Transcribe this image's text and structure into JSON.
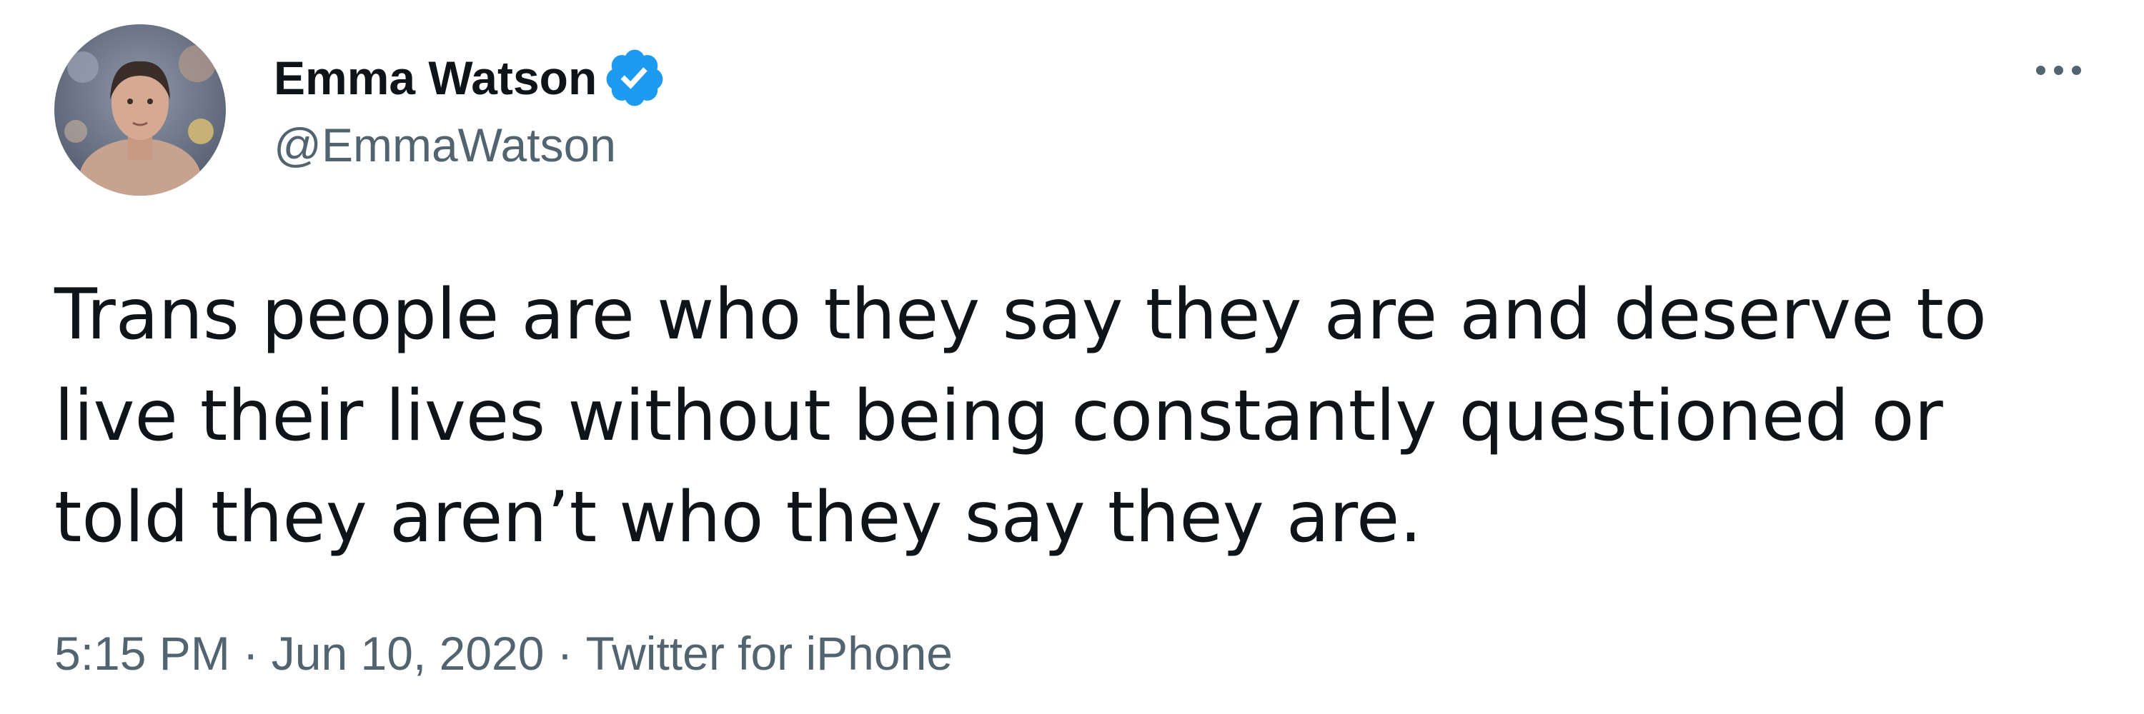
{
  "author": {
    "display_name": "Emma Watson",
    "handle": "@EmmaWatson",
    "verified": true,
    "verified_icon": "verified-badge-icon",
    "verified_color": "#1d9bf0"
  },
  "tweet": {
    "text_lines": [
      "Trans people are who they say they are and deserve to",
      "live their lives without being constantly questioned or",
      "told they aren’t who they say they are."
    ]
  },
  "meta": {
    "time": "5:15 PM",
    "separator": "·",
    "date": "Jun 10, 2020",
    "source": "Twitter for iPhone"
  },
  "menu": {
    "icon": "more-options-icon"
  },
  "colors": {
    "text_primary": "#0f1419",
    "text_secondary": "#536471",
    "background": "#ffffff"
  }
}
